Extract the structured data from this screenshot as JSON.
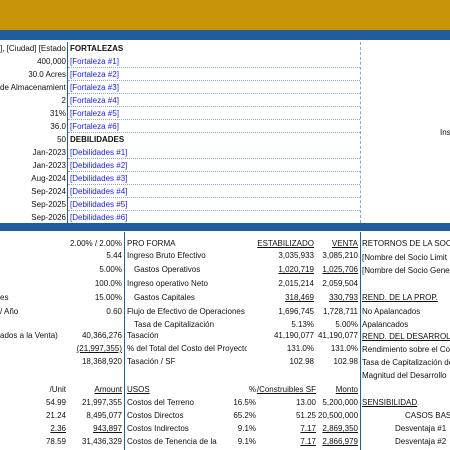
{
  "header": {
    "location_label": "], [Ciudad] [Estado]",
    "fortalezas_title": "FORTALEZAS",
    "debilidades_title": "DEBILIDADES",
    "side_label": "Ins"
  },
  "top_left_values": [
    "400,000",
    "30.0 Acres",
    "de Almacenamiento",
    "2",
    "31%",
    "36.0",
    "50",
    "Jan-2023",
    "Jan-2023",
    "Aug-2024",
    "Sep-2024",
    "Sep-2025",
    "Sep-2026"
  ],
  "fortalezas": [
    "[Fortaleza #1]",
    "[Fortaleza #2]",
    "[Fortaleza #3]",
    "[Fortaleza #4]",
    "[Fortaleza #5]",
    "[Fortaleza #6]"
  ],
  "debilidades": [
    "[Debilidades #1]",
    "[Debilidades #2]",
    "[Debilidades #3]",
    "[Debilidades #4]",
    "[Debilidades #5]",
    "[Debilidades #6]"
  ],
  "left_mid": {
    "rate_values": "2.00% / 2.00%",
    "vals": [
      "5.44",
      "5.00%",
      "100.0%",
      "15.00%"
    ],
    "labels": [
      "es",
      "/ Año",
      "ados a la Venta)"
    ],
    "fcf_value": "0.60",
    "big1": "40,366,276",
    "big2": "(21,997,355)",
    "big3": "18,368,920"
  },
  "proforma": {
    "title": "PRO FORMA",
    "col_estab": "ESTABILIZADO",
    "col_venta": "VENTA",
    "rows": [
      {
        "label": "Ingreso Bruto Efectivo",
        "estab": "3,035,933",
        "venta": "3,085,210"
      },
      {
        "label": "Gastos Operativos",
        "estab": "1,020,719",
        "venta": "1,025,706"
      },
      {
        "label": "Ingreso operativo Neto",
        "estab": "2,015,214",
        "venta": "2,059,504"
      },
      {
        "label": "Gastos Capitales",
        "estab": "318,469",
        "venta": "330,793"
      },
      {
        "label": "Flujo de Efectivo de Operaciones",
        "estab": "1,696,745",
        "venta": "1,728,711"
      },
      {
        "label": "Tasa de Capitalización",
        "estab": "5.13%",
        "venta": "5.00%"
      },
      {
        "label": "Tasación",
        "estab": "41,190,077",
        "venta": "41,190,077"
      },
      {
        "label": "% del Total del Costo del Proyecto",
        "estab": "131.0%",
        "venta": "131.0%"
      },
      {
        "label": "Tasación / SF",
        "estab": "102.98",
        "venta": "102.98"
      }
    ]
  },
  "right_panel": {
    "retornos": "RETORNOS DE LA SOC.",
    "socio1": "[Nombre del Socio Limit",
    "socio2": "[Nombre del Socio Gene",
    "rend_prop": "REND. DE LA PROP.",
    "no_apal": "No Apalancados",
    "apal": "Apalancados",
    "rend_des": "REND. DEL DESARROLLO",
    "rend_sobre": "Rendimiento sobre el Co",
    "tasa_cap": "Tasa de Capitalización de",
    "magnitud": "Magnitud del Desarrollo"
  },
  "usos": {
    "left_headers": [
      "/Unit",
      "Amount"
    ],
    "title": "USOS",
    "col_pct": "%",
    "col_sf": "/Construibles SF",
    "col_monto": "Monto",
    "left_rows": [
      {
        "unit": "54.99",
        "amount": "21,997,355"
      },
      {
        "unit": "21.24",
        "amount": "8,495,077"
      },
      {
        "unit": "2.36",
        "amount": "943,897"
      },
      {
        "unit": "78.59",
        "amount": "31,436,329"
      }
    ],
    "rows": [
      {
        "label": "Costos del Terreno",
        "pct": "16.5%",
        "sf": "13.00",
        "monto": "5,200,000"
      },
      {
        "label": "Costos Directos",
        "pct": "65.2%",
        "sf": "51.25",
        "monto": "20,500,000"
      },
      {
        "label": "Costos Indirectos",
        "pct": "9.1%",
        "sf": "7.17",
        "monto": "2,869,350"
      },
      {
        "label": "Costos de Tenencia de la",
        "pct": "9.1%",
        "sf": "7.17",
        "monto": "2,866,979"
      }
    ]
  },
  "sensibilidad": {
    "title": "SENSIBILIDAD",
    "casos": "CASOS BASE",
    "d1": "Desventaja #1",
    "d2": "Desventaja #2"
  }
}
